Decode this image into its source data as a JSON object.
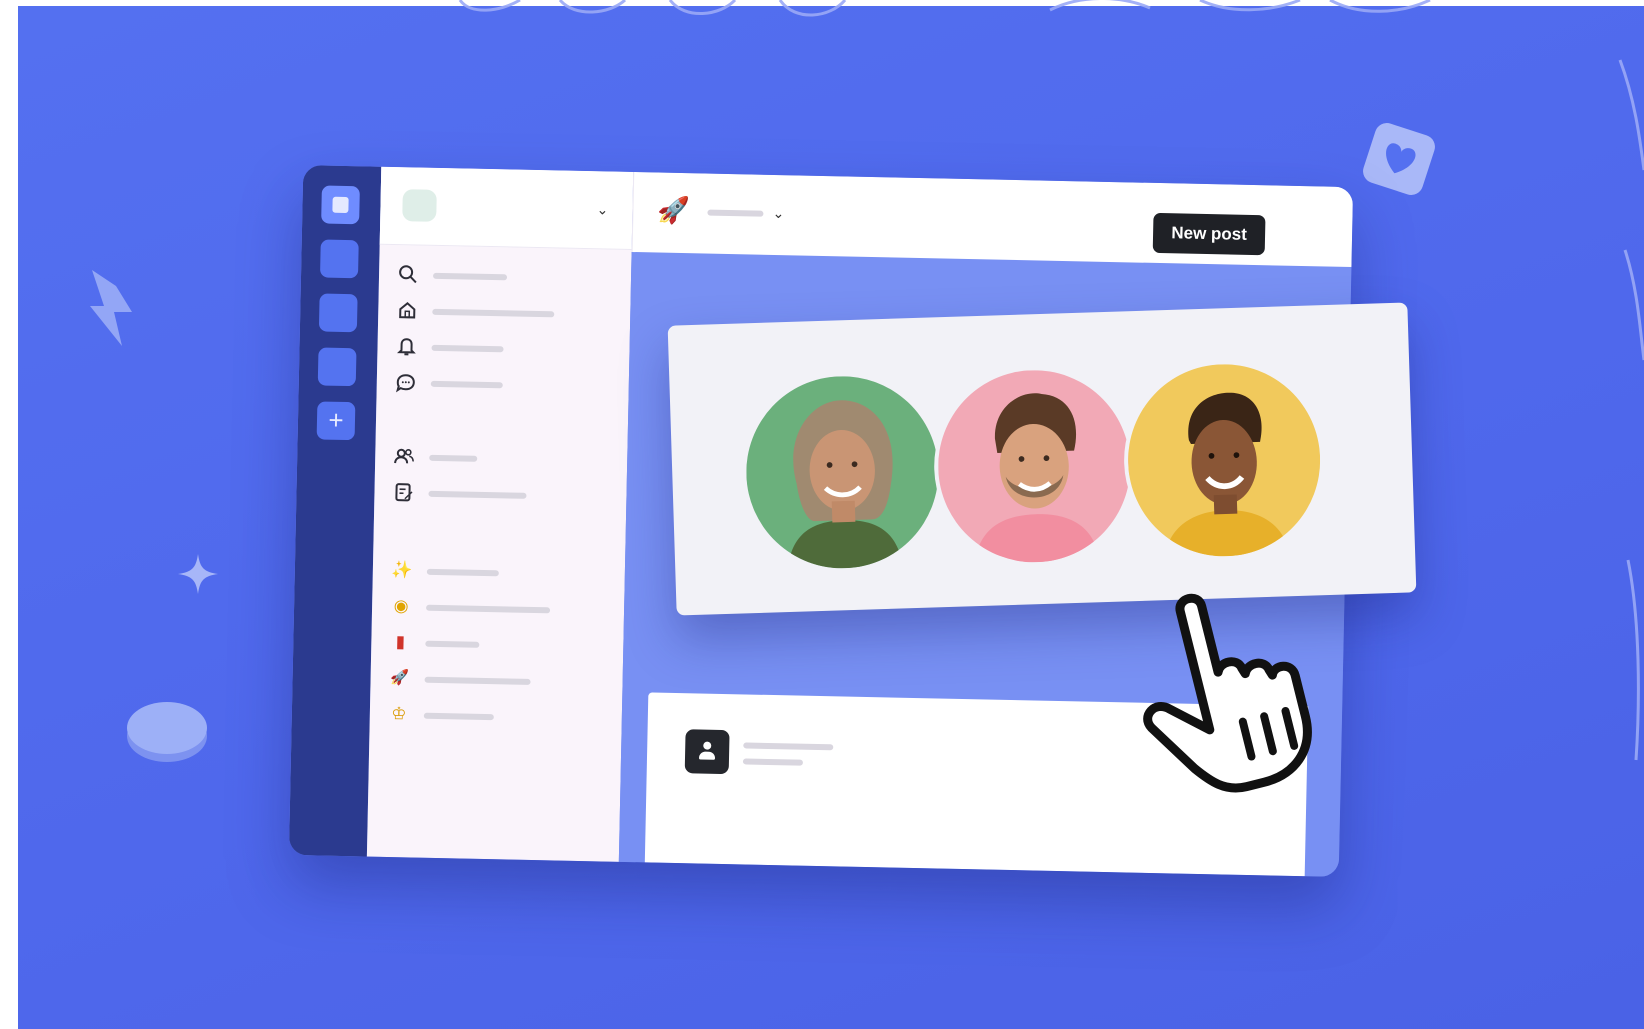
{
  "topbar": {
    "new_post_label": "New post",
    "channel_icon": "rocket-emoji"
  },
  "rail": {
    "items": [
      "workspace-icon",
      "space-1",
      "space-2",
      "space-3"
    ],
    "add_icon": "plus-icon"
  },
  "sidebar": {
    "nav_icons": [
      "search-icon",
      "home-icon",
      "bell-icon",
      "chat-icon",
      "people-icon",
      "notes-icon"
    ],
    "space_emojis": [
      "sparkles-emoji",
      "handshake-emoji",
      "book-emoji",
      "rocket-emoji",
      "trophy-emoji"
    ]
  },
  "people": [
    {
      "name": "person-1",
      "bg_color": "#6bb07c"
    },
    {
      "name": "person-2",
      "bg_color": "#f2a9b6"
    },
    {
      "name": "person-3",
      "bg_color": "#f1c95c"
    }
  ],
  "colors": {
    "background": "#5470f0",
    "rail": "#2b3a8f",
    "button": "#1f2126"
  }
}
